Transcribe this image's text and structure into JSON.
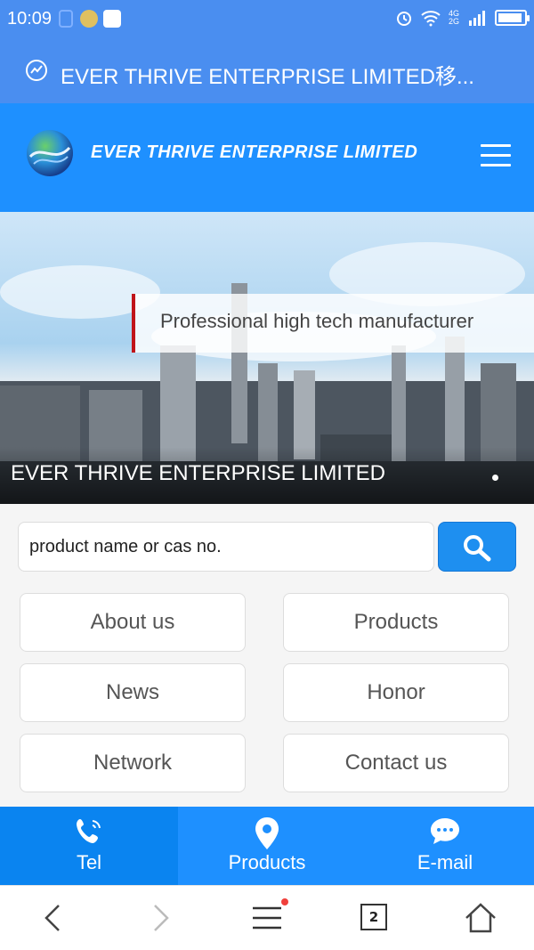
{
  "status_bar": {
    "time": "10:09",
    "network": "4G 2G",
    "icons": [
      "alarm-icon",
      "wifi-icon",
      "signal-icon",
      "battery-icon"
    ]
  },
  "browser": {
    "page_title": "EVER THRIVE ENTERPRISE LIMITED移...",
    "tab_count": "2"
  },
  "header": {
    "brand": "EVER THRIVE ENTERPRISE LIMITED",
    "menu_icon": "hamburger-icon"
  },
  "banner": {
    "tagline": "Professional high tech manufacturer",
    "caption": "EVER THRIVE ENTERPRISE LIMITED"
  },
  "search": {
    "placeholder": "product name or cas no.",
    "button_icon": "search-icon"
  },
  "nav": {
    "items": [
      {
        "label": "About us"
      },
      {
        "label": "Products"
      },
      {
        "label": "News"
      },
      {
        "label": "Honor"
      },
      {
        "label": "Network"
      },
      {
        "label": "Contact us"
      }
    ]
  },
  "contact_bar": {
    "items": [
      {
        "label": "Tel",
        "icon": "phone-icon"
      },
      {
        "label": "Products",
        "icon": "location-pin-icon"
      },
      {
        "label": "E-mail",
        "icon": "chat-bubble-icon"
      }
    ]
  },
  "colors": {
    "status_bar": "#4a8ef0",
    "header": "#1e90ff",
    "search_button": "#1e8ff0",
    "tagline_accent": "#c0141a"
  }
}
